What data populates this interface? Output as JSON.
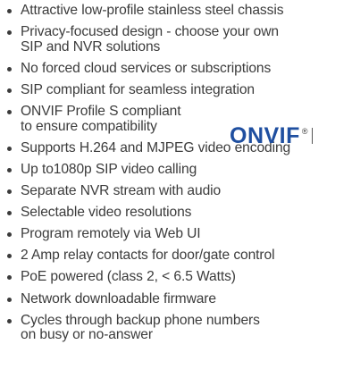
{
  "features": [
    "Attractive low-profile stainless steel chassis",
    "Privacy-focused design - choose your own\nSIP and NVR solutions",
    "No forced cloud services or subscriptions",
    "SIP compliant for seamless integration",
    "ONVIF Profile S compliant\nto ensure compatibility",
    "Supports H.264 and MJPEG video encoding",
    "Up to1080p SIP video calling",
    "Separate NVR stream with audio",
    "Selectable video resolutions",
    "Program remotely via Web UI",
    "2 Amp relay contacts for door/gate control",
    "PoE powered (class 2, < 6.5 Watts)",
    "Network downloadable firmware",
    "Cycles through backup phone numbers\non busy or no-answer"
  ],
  "onvif_logo": {
    "text": "ONVIF",
    "registered_mark": "®",
    "color": "#1f4fa0"
  },
  "colors": {
    "text": "#3b3b3b",
    "logo_blue": "#1f4fa0"
  }
}
